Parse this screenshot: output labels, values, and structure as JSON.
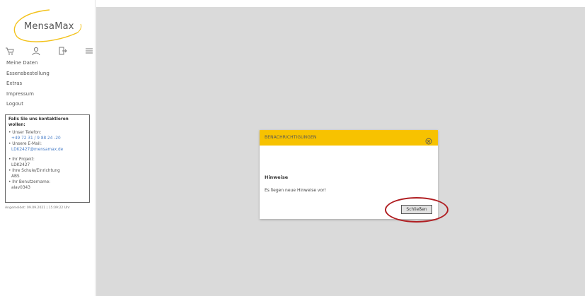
{
  "app": {
    "logo_text": "MensaMax"
  },
  "icons": [
    "cart-icon",
    "user-icon",
    "logout-icon",
    "menu-icon"
  ],
  "menu": {
    "items": [
      {
        "label": "Meine Daten"
      },
      {
        "label": "Essensbestellung"
      },
      {
        "label": "Extras"
      },
      {
        "label": "Impressum"
      },
      {
        "label": "Logout"
      }
    ]
  },
  "contact": {
    "title": "Falls Sie uns kontaktieren wollen:",
    "phone_label": "• Unser Telefon:",
    "phone": "+49 72 31 / 9 88 24 -20",
    "email_label": "• Unsere E-Mail:",
    "email": "LDK2427@mensamax.de",
    "project_label": "• Ihr Projekt:",
    "project": "LDK2427",
    "school_label": "• Ihre Schule/Einrichtung",
    "school": "ABS",
    "username_label": "• Ihr Benutzername:",
    "username": "alav0343"
  },
  "login_info": "Angemeldet: 09.09.2021 | 15:09:22 Uhr",
  "modal": {
    "title": "BENACHRICHTIGUNGEN",
    "heading": "Hinweise",
    "message": "Es liegen neue Hinweise vor!",
    "close_button": "Schließen"
  },
  "colors": {
    "header": "#f7c200",
    "overlay": "#dadada",
    "link": "#4a7fc9",
    "highlight": "#b01e22"
  }
}
